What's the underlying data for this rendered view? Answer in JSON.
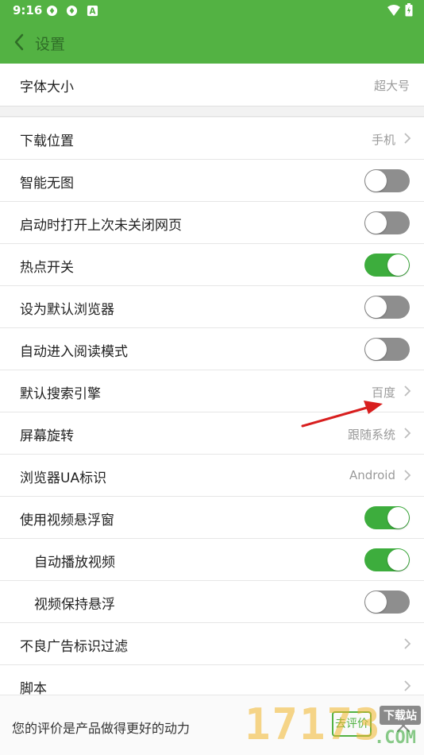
{
  "status_bar": {
    "time": "9:16"
  },
  "app_bar": {
    "title": "设置"
  },
  "group1": [
    {
      "label": "字体大小",
      "value": "超大号"
    }
  ],
  "group2": [
    {
      "label": "下载位置",
      "value": "手机"
    },
    {
      "label": "智能无图",
      "toggle": false
    },
    {
      "label": "启动时打开上次未关闭网页",
      "toggle": false
    },
    {
      "label": "热点开关",
      "toggle": true
    },
    {
      "label": "设为默认浏览器",
      "toggle": false
    },
    {
      "label": "自动进入阅读模式",
      "toggle": false
    },
    {
      "label": "默认搜索引擎",
      "value": "百度"
    },
    {
      "label": "屏幕旋转",
      "value": "跟随系统"
    },
    {
      "label": "浏览器UA标识",
      "value": "Android"
    },
    {
      "label": "使用视频悬浮窗",
      "toggle": true
    },
    {
      "label": "自动播放视频",
      "toggle": true
    },
    {
      "label": "视频保持悬浮",
      "toggle": false
    },
    {
      "label": "不良广告标识过滤"
    },
    {
      "label": "脚本"
    }
  ],
  "banner": {
    "message": "您的评价是产品做得更好的动力",
    "rate_button": "去评价"
  },
  "watermark": {
    "number": "17173",
    "tag": "下载站",
    "domain": ".COM"
  },
  "colors": {
    "accent": "#53b243",
    "toggle_on": "#3dad3d",
    "toggle_off": "#8e8e8e",
    "annotation_arrow": "#d81e1e"
  }
}
